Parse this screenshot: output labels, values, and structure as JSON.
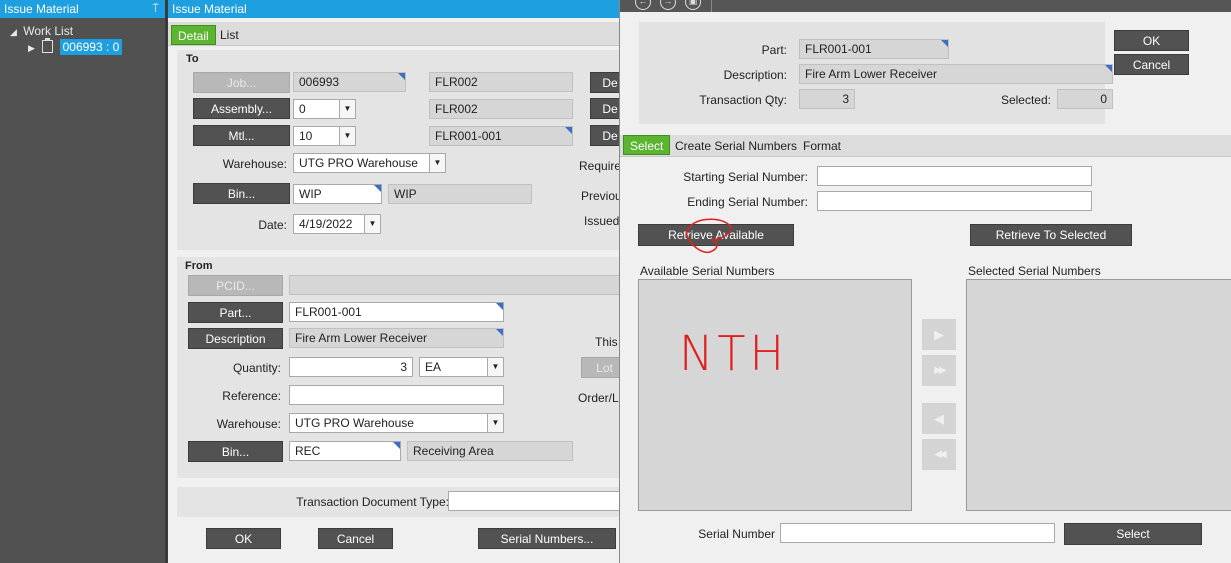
{
  "worklist": {
    "title": "Work List",
    "panel_title": "Issue Material",
    "pin_glyph": "⍑",
    "root_label": "Work List",
    "child_label": "006993 : 0"
  },
  "issue": {
    "title": "Issue Material",
    "tabs": [
      "Detail",
      "List"
    ],
    "to": {
      "label": "To",
      "job_button": "Job...",
      "job_value": "006993",
      "job_desc": "FLR002",
      "assembly_button": "Assembly...",
      "assembly_value": "0",
      "assembly_desc": "FLR002",
      "mtl_button": "Mtl...",
      "mtl_value": "10",
      "mtl_desc": "FLR001-001",
      "de_button": "De",
      "warehouse_label": "Warehouse:",
      "warehouse_value": "UTG PRO Warehouse",
      "bin_button": "Bin...",
      "bin_value": "WIP",
      "bin_desc": "WIP",
      "date_label": "Date:",
      "date_value": "4/19/2022",
      "require_label": "Require",
      "previous_label": "Previou",
      "issued_label": "Issued"
    },
    "from": {
      "label": "From",
      "pcid_button": "PCID...",
      "part_button": "Part...",
      "part_value": "FLR001-001",
      "description_button": "Description",
      "description_value": "Fire Arm Lower Receiver",
      "quantity_label": "Quantity:",
      "quantity_value": "3",
      "uom_value": "EA",
      "reference_label": "Reference:",
      "reference_value": "",
      "warehouse_label": "Warehouse:",
      "warehouse_value": "UTG PRO Warehouse",
      "bin_button": "Bin...",
      "bin_value": "REC",
      "bin_desc": "Receiving Area",
      "this_label": "This",
      "lot_button": "Lot",
      "order_label": "Order/L"
    },
    "trans_doc_label": "Transaction Document Type:",
    "trans_doc_value": "",
    "ok_button": "OK",
    "cancel_button": "Cancel",
    "serial_button": "Serial Numbers..."
  },
  "serial": {
    "nav_icons": [
      "←",
      "→",
      "▣"
    ],
    "part_label": "Part:",
    "part_value": "FLR001-001",
    "description_label": "Description:",
    "description_value": "Fire Arm Lower Receiver",
    "qty_label": "Transaction Qty:",
    "qty_value": "3",
    "selected_label": "Selected:",
    "selected_value": "0",
    "ok_button": "OK",
    "cancel_button": "Cancel",
    "tabs": [
      "Select",
      "Create Serial Numbers",
      "Format"
    ],
    "starting_label": "Starting Serial Number:",
    "starting_value": "",
    "ending_label": "Ending Serial Number:",
    "ending_value": "",
    "retrieve_available_button": "Retrieve Available",
    "retrieve_selected_button": "Retrieve To Selected",
    "available_label": "Available Serial Numbers",
    "selected_list_label": "Selected Serial Numbers",
    "handwritten_note": "NTH",
    "arrow_glyphs": [
      "▶",
      "▶▶",
      "◀",
      "◀◀"
    ],
    "serial_number_label": "Serial Number",
    "serial_number_value": "",
    "select_button": "Select"
  },
  "colors": {
    "accent": "#1e9fe0",
    "active_tab": "#5cb531",
    "button": "#525252",
    "annotation": "#e02020"
  }
}
